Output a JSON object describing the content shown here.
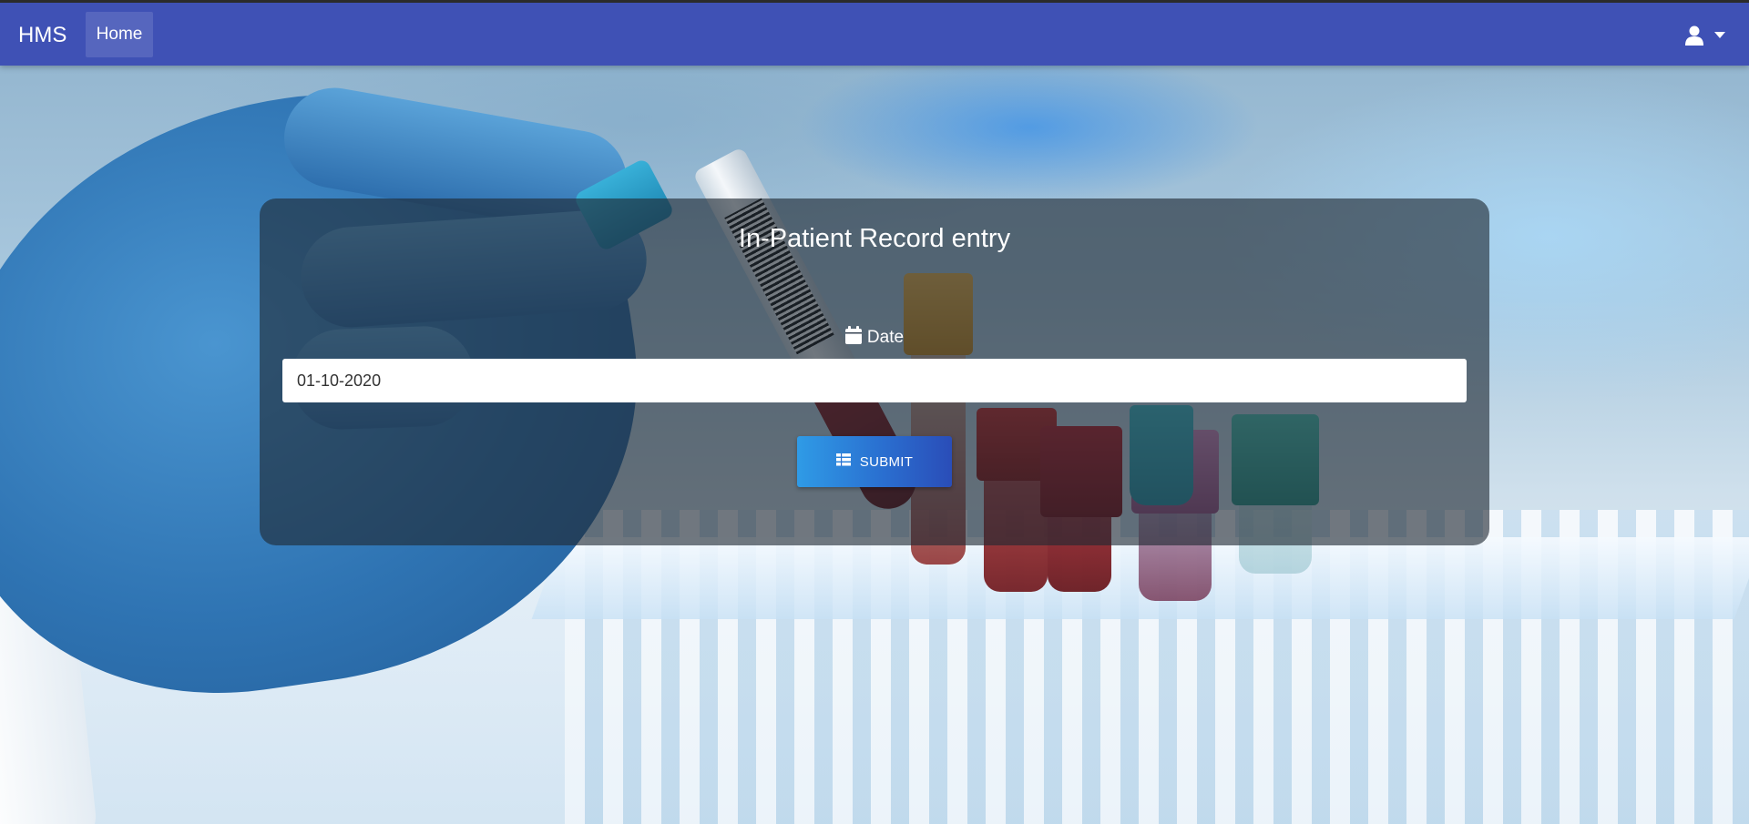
{
  "navbar": {
    "brand": "HMS",
    "home_label": "Home",
    "user_icon": "user-icon",
    "caret_icon": "caret-down-icon",
    "background_color": "#3f51b5"
  },
  "form": {
    "title": "In-Patient Record entry",
    "date_label": "Date",
    "date_icon": "calendar-icon",
    "date_value": "01-10-2020",
    "submit_label": "SUBMIT",
    "submit_icon": "table-icon"
  },
  "colors": {
    "card_background": "rgba(30,40,50,0.62)",
    "submit_gradient_start": "#2f9be6",
    "submit_gradient_end": "#2a4db8"
  }
}
